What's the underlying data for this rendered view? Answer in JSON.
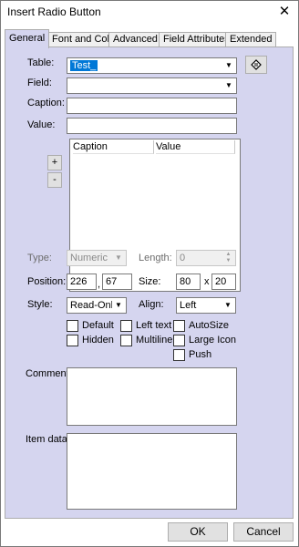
{
  "window": {
    "title": "Insert Radio Button",
    "close_glyph": "✕"
  },
  "tabs": [
    {
      "label": "General",
      "active": true
    },
    {
      "label": "Font and Color",
      "active": false
    },
    {
      "label": "Advanced",
      "active": false
    },
    {
      "label": "Field Attributes",
      "active": false
    },
    {
      "label": "Extended",
      "active": false
    }
  ],
  "form": {
    "table_label": "Table:",
    "table_value": "Test_",
    "field_label": "Field:",
    "field_value": "",
    "caption_label": "Caption:",
    "caption_value": "",
    "value_label": "Value:",
    "value_value": "",
    "list_columns": [
      "Caption",
      "Value"
    ],
    "add_label": "+",
    "remove_label": "-",
    "type_label": "Type:",
    "type_value": "Numeric",
    "length_label": "Length:",
    "length_value": "0",
    "position_label": "Position:",
    "position_x": "226",
    "position_sep": ",",
    "position_y": "67",
    "size_label": "Size:",
    "size_w": "80",
    "size_sep": "x",
    "size_h": "20",
    "style_label": "Style:",
    "style_value": "Read-Only",
    "align_label": "Align:",
    "align_value": "Left",
    "checkboxes": {
      "default": {
        "label": "Default",
        "checked": false
      },
      "hidden": {
        "label": "Hidden",
        "checked": false
      },
      "left_text": {
        "label": "Left text",
        "checked": false
      },
      "multiline": {
        "label": "Multiline",
        "checked": false
      },
      "autosize": {
        "label": "AutoSize",
        "checked": false
      },
      "large_icon": {
        "label": "Large Icon",
        "checked": false
      },
      "push": {
        "label": "Push",
        "checked": false
      }
    },
    "comment_label": "Comment:",
    "comment_value": "",
    "item_data_label": "Item data:",
    "item_data_value": ""
  },
  "footer": {
    "ok_label": "OK",
    "cancel_label": "Cancel"
  },
  "colors": {
    "panel": "#d5d5ef",
    "selection": "#0078d7"
  },
  "icons": {
    "dropdown": "chevron-down-icon",
    "lookup": "table-lookup-icon",
    "close": "close-icon"
  }
}
